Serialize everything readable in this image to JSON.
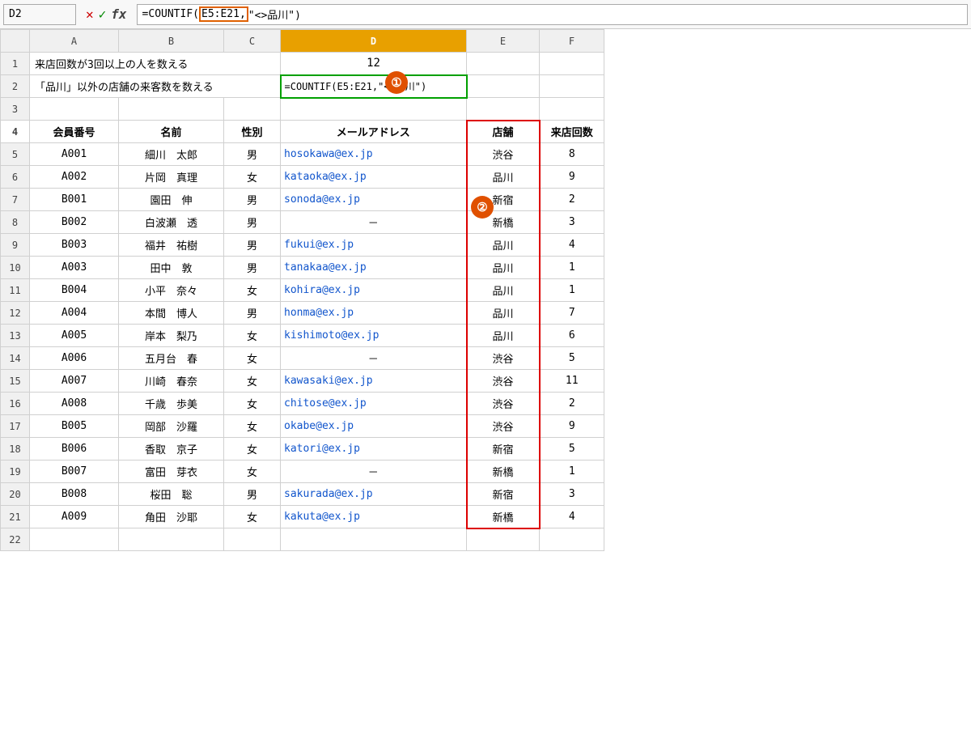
{
  "formulaBar": {
    "cellRef": "D2",
    "formula": "=COUNTIF(E5:E21,\"<>品川\")",
    "formulaDisplay": "=COUNTIF(E5:E21,\"<>品川\")",
    "formulaPrefix": "=COUNTIF(",
    "formulaHighlight": "E5:E21,",
    "formulaSuffix": "\"<>品川\")"
  },
  "columns": {
    "rowNum": "",
    "A": "A",
    "B": "B",
    "C": "C",
    "D": "D",
    "E": "E",
    "F": "F"
  },
  "rows": [
    {
      "rowNum": "1",
      "A": "来店回数が3回以上の人を数える",
      "B": "",
      "C": "",
      "D": "12",
      "E": "",
      "F": ""
    },
    {
      "rowNum": "2",
      "A": "「品川」以外の店舗の来客数を数える",
      "B": "",
      "C": "",
      "D": "=COUNTIF(E5:E21,\"<>品川\")",
      "E": "",
      "F": ""
    },
    {
      "rowNum": "3",
      "A": "",
      "B": "",
      "C": "",
      "D": "",
      "E": "",
      "F": ""
    },
    {
      "rowNum": "4",
      "A": "会員番号",
      "B": "名前",
      "C": "性別",
      "D": "メールアドレス",
      "E": "店舗",
      "F": "来店回数"
    },
    {
      "rowNum": "5",
      "A": "A001",
      "B": "細川　太郎",
      "C": "男",
      "D": "hosokawa@ex.jp",
      "E": "渋谷",
      "F": "8"
    },
    {
      "rowNum": "6",
      "A": "A002",
      "B": "片岡　真理",
      "C": "女",
      "D": "kataoka@ex.jp",
      "E": "品川",
      "F": "9"
    },
    {
      "rowNum": "7",
      "A": "B001",
      "B": "園田　伸",
      "C": "男",
      "D": "sonoda@ex.jp",
      "E": "新宿",
      "F": "2"
    },
    {
      "rowNum": "8",
      "A": "B002",
      "B": "白波瀬　透",
      "C": "男",
      "D": "-",
      "E": "新橋",
      "F": "3"
    },
    {
      "rowNum": "9",
      "A": "B003",
      "B": "福井　祐樹",
      "C": "男",
      "D": "fukui@ex.jp",
      "E": "品川",
      "F": "4"
    },
    {
      "rowNum": "10",
      "A": "A003",
      "B": "田中　敦",
      "C": "男",
      "D": "tanakaa@ex.jp",
      "E": "品川",
      "F": "1"
    },
    {
      "rowNum": "11",
      "A": "B004",
      "B": "小平　奈々",
      "C": "女",
      "D": "kohira@ex.jp",
      "E": "品川",
      "F": "1"
    },
    {
      "rowNum": "12",
      "A": "A004",
      "B": "本間　博人",
      "C": "男",
      "D": "honma@ex.jp",
      "E": "品川",
      "F": "7"
    },
    {
      "rowNum": "13",
      "A": "A005",
      "B": "岸本　梨乃",
      "C": "女",
      "D": "kishimoto@ex.jp",
      "E": "品川",
      "F": "6"
    },
    {
      "rowNum": "14",
      "A": "A006",
      "B": "五月台　春",
      "C": "女",
      "D": "-",
      "E": "渋谷",
      "F": "5"
    },
    {
      "rowNum": "15",
      "A": "A007",
      "B": "川崎　春奈",
      "C": "女",
      "D": "kawasaki@ex.jp",
      "E": "渋谷",
      "F": "11"
    },
    {
      "rowNum": "16",
      "A": "A008",
      "B": "千歳　歩美",
      "C": "女",
      "D": "chitose@ex.jp",
      "E": "渋谷",
      "F": "2"
    },
    {
      "rowNum": "17",
      "A": "B005",
      "B": "岡部　沙羅",
      "C": "女",
      "D": "okabe@ex.jp",
      "E": "渋谷",
      "F": "9"
    },
    {
      "rowNum": "18",
      "A": "B006",
      "B": "香取　京子",
      "C": "女",
      "D": "katori@ex.jp",
      "E": "新宿",
      "F": "5"
    },
    {
      "rowNum": "19",
      "A": "B007",
      "B": "富田　芽衣",
      "C": "女",
      "D": "-",
      "E": "新橋",
      "F": "1"
    },
    {
      "rowNum": "20",
      "A": "B008",
      "B": "桜田　聡",
      "C": "男",
      "D": "sakurada@ex.jp",
      "E": "新宿",
      "F": "3"
    },
    {
      "rowNum": "21",
      "A": "A009",
      "B": "角田　沙耶",
      "C": "女",
      "D": "kakuta@ex.jp",
      "E": "新橋",
      "F": "4"
    },
    {
      "rowNum": "22",
      "A": "",
      "B": "",
      "C": "",
      "D": "",
      "E": "",
      "F": ""
    }
  ],
  "annotations": {
    "circle1": "①",
    "circle2": "②"
  }
}
